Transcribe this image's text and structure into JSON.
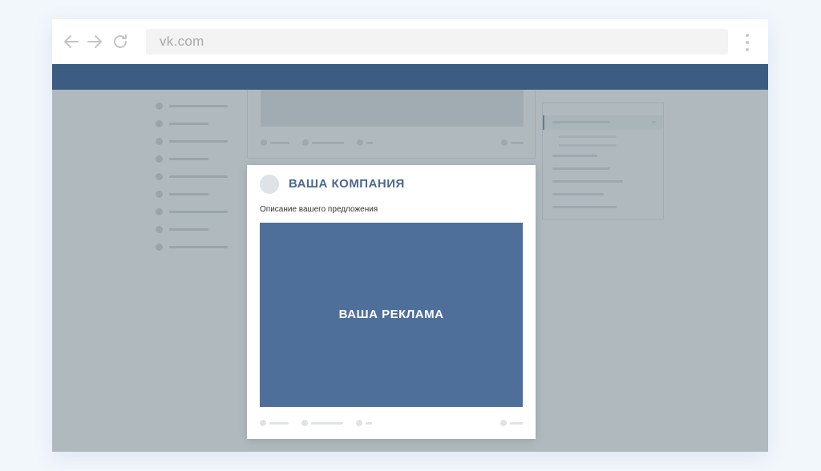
{
  "browser": {
    "back_icon": "arrow-left-icon",
    "forward_icon": "arrow-right-icon",
    "reload_icon": "reload-icon",
    "url": "vk.com",
    "menu_icon": "vertical-dots-icon"
  },
  "colors": {
    "vk_header": "#3d5c82",
    "ad_banner": "#4f6f9b",
    "company_text": "#4a6890"
  },
  "ad": {
    "company": "ВАША КОМПАНИЯ",
    "description": "Описание вашего предложения",
    "banner_text": "ВАША РЕКЛАМА"
  }
}
